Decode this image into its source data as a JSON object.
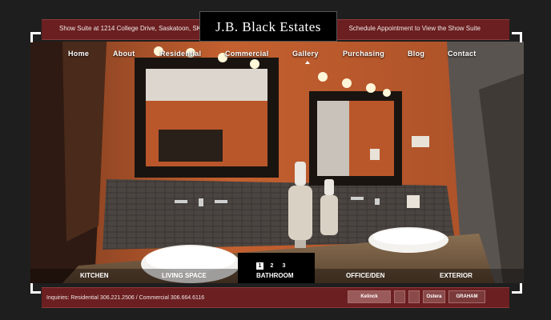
{
  "header": {
    "left_text": "Show Suite at 1214 College Drive, Saskatoon, SK",
    "right_text": "Schedule Appointment to View the Show Suite",
    "logo": "J.B. Black Estates"
  },
  "nav": {
    "items": [
      {
        "label": "Home"
      },
      {
        "label": "About"
      },
      {
        "label": "Residential"
      },
      {
        "label": "Commercial"
      },
      {
        "label": "Gallery"
      },
      {
        "label": "Purchasing"
      },
      {
        "label": "Blog"
      },
      {
        "label": "Contact"
      }
    ],
    "active": "Gallery"
  },
  "gallery": {
    "pages": [
      "1",
      "2",
      "3"
    ],
    "active_page": "1",
    "rooms": [
      {
        "label": "KITCHEN"
      },
      {
        "label": "LIVING SPACE"
      },
      {
        "label": "BATHROOM"
      },
      {
        "label": "OFFICE/DEN"
      },
      {
        "label": "EXTERIOR"
      }
    ],
    "active_room": "BATHROOM"
  },
  "footer": {
    "inquiries": "Inquiries: Residential 306.221.2506  /  Commercial 306.664.6116",
    "partner_logos": [
      "Kelinck",
      "",
      "Ostera",
      "GRAHAM"
    ]
  },
  "colors": {
    "bar": "#6b1f20",
    "wall": "#c05a2f",
    "background": "#1e1e1e"
  }
}
